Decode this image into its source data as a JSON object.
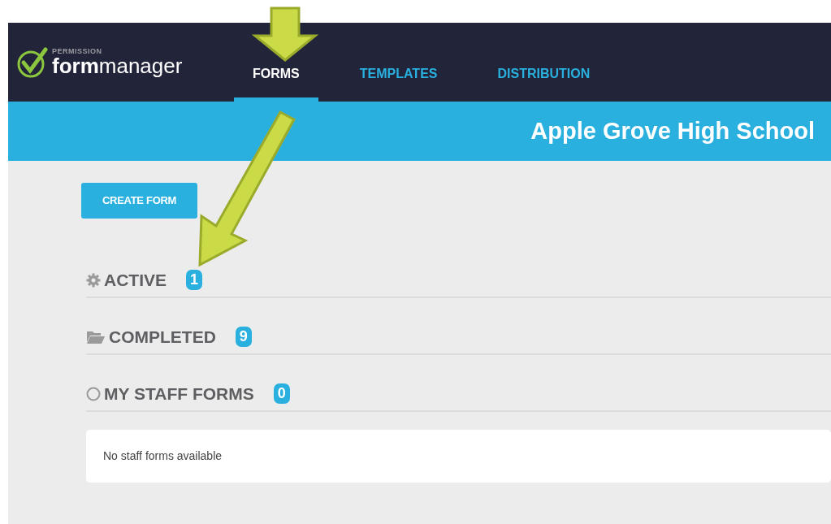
{
  "logo": {
    "tagline": "PERMISSION",
    "wordmark": "**form**manager"
  },
  "tabs": [
    {
      "label": "FORMS",
      "selected": true
    },
    {
      "label": "TEMPLATES",
      "selected": false
    },
    {
      "label": "DISTRIBUTION",
      "selected": false
    }
  ],
  "banner": {
    "title": "Apple Grove High School"
  },
  "create_button": "CREATE FORM",
  "sections": [
    {
      "kind": "gear",
      "title": "ACTIVE",
      "count": "1"
    },
    {
      "kind": "folder",
      "title": "COMPLETED",
      "count": "9"
    },
    {
      "kind": "circle",
      "title": "MY STAFF FORMS",
      "count": "0",
      "empty_message": "No staff forms available"
    }
  ]
}
